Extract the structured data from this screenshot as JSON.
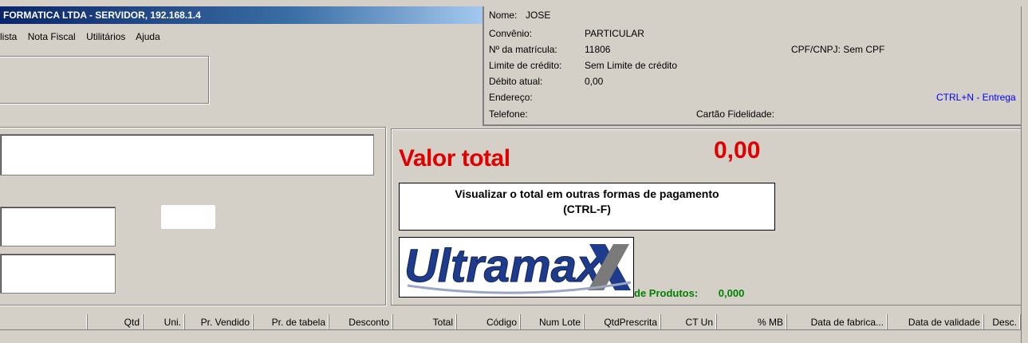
{
  "window": {
    "title": "FORMATICA LTDA - SERVIDOR, 192.168.1.4"
  },
  "menu": [
    "lista",
    "Nota Fiscal",
    "Utilitários",
    "Ajuda"
  ],
  "customer": {
    "nome_label": "Nome:",
    "nome": "JOSE",
    "convenio_label": "Convênio:",
    "convenio": "PARTICULAR",
    "matricula_label": "Nº da matrícula:",
    "matricula": "11806",
    "cpf": "CPF/CNPJ: Sem CPF",
    "limite_label": "Limite de crédito:",
    "limite": "Sem Limite de crédito",
    "debito_label": "Débito atual:",
    "debito": "0,00",
    "endereco_label": "Endereço:",
    "telefone_label": "Telefone:",
    "cartao_label": "Cartão Fidelidade:",
    "entrega_shortcut": "CTRL+N - Entrega"
  },
  "total": {
    "label": "Valor total",
    "amount": "0,00",
    "formas_line1": "Visualizar o total em outras formas de pagamento",
    "formas_line2": "(CTRL-F)",
    "produtos_label": "de Produtos:",
    "produtos_value": "0,000"
  },
  "logo": {
    "text": "Ultramax"
  },
  "grid": {
    "columns": [
      "Qtd",
      "Uni.",
      "Pr. Vendido",
      "Pr. de tabela",
      "Desconto",
      "Total",
      "Código",
      "Num Lote",
      "QtdPrescrita",
      "CT Un",
      "% MB",
      "Data de fabrica...",
      "Data de validade",
      "Desc."
    ]
  },
  "colors": {
    "accent_red": "#e00000",
    "link_blue": "#0000ff",
    "green": "#008000",
    "title_blue": "#0a246a"
  }
}
